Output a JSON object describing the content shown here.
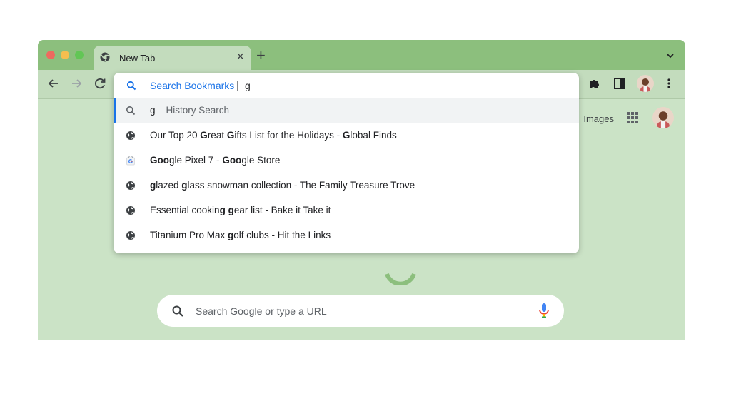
{
  "tab": {
    "title": "New Tab"
  },
  "omnibox": {
    "keyword_label": "Search Bookmarks",
    "separator": "|",
    "typed_text": "g",
    "history_row": {
      "query": "g",
      "suffix": " – History Search"
    },
    "suggestions": [
      {
        "icon": "globe-icon",
        "parts": [
          {
            "t": "Our Top 20 "
          },
          {
            "t": "G",
            "b": true
          },
          {
            "t": "reat "
          },
          {
            "t": "G",
            "b": true
          },
          {
            "t": "ifts List for the Holidays  - "
          },
          {
            "t": "G",
            "b": true
          },
          {
            "t": "lobal Finds"
          }
        ]
      },
      {
        "icon": "google-store-icon",
        "parts": [
          {
            "t": "Goo",
            "b": true
          },
          {
            "t": "g"
          },
          {
            "t": "le",
            "b": false
          },
          {
            "t": " Pixel 7 - "
          },
          {
            "t": "Goo",
            "b": true
          },
          {
            "t": "g"
          },
          {
            "t": "le Store"
          }
        ]
      },
      {
        "icon": "globe-icon",
        "parts": [
          {
            "t": "g",
            "b": true
          },
          {
            "t": "lazed "
          },
          {
            "t": "g",
            "b": true
          },
          {
            "t": "lass snowman collection - The Family Treasure Trove"
          }
        ]
      },
      {
        "icon": "globe-icon",
        "parts": [
          {
            "t": "Essential cookin"
          },
          {
            "t": "g",
            "b": true
          },
          {
            "t": " "
          },
          {
            "t": "g",
            "b": true
          },
          {
            "t": "ear list - Bake it Take it"
          }
        ]
      },
      {
        "icon": "globe-icon",
        "parts": [
          {
            "t": "Titanium Pro Max "
          },
          {
            "t": "g",
            "b": true
          },
          {
            "t": "olf clubs - Hit the Links"
          }
        ]
      }
    ]
  },
  "ntp": {
    "images_link": "Images",
    "search_placeholder": "Search Google or type a URL"
  },
  "colors": {
    "tabstrip": "#8cbf7d",
    "toolbar": "#c3dcbd",
    "page": "#cbe3c6",
    "accent": "#1a73e8"
  }
}
